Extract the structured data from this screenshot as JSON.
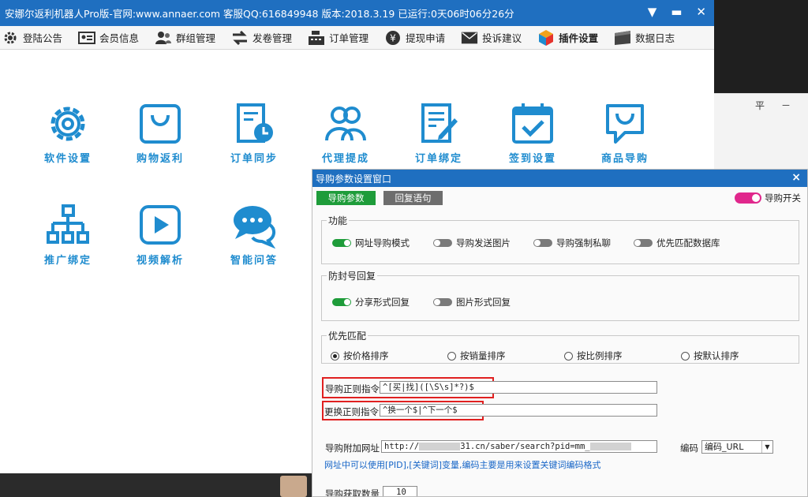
{
  "main_window": {
    "title": "安娜尔返利机器人Pro版-官网:www.annaer.com 客服QQ:616849948 版本:2018.3.19      已运行:0天06时06分26分"
  },
  "toolbar": {
    "items": [
      {
        "label": "登陆公告",
        "icon": "settings-icon"
      },
      {
        "label": "会员信息",
        "icon": "id-card-icon"
      },
      {
        "label": "群组管理",
        "icon": "users-icon"
      },
      {
        "label": "发卷管理",
        "icon": "exchange-icon"
      },
      {
        "label": "订单管理",
        "icon": "cash-register-icon"
      },
      {
        "label": "提现申请",
        "icon": "yen-icon"
      },
      {
        "label": "投诉建议",
        "icon": "mail-icon"
      },
      {
        "label": "插件设置",
        "icon": "cube-icon"
      },
      {
        "label": "数据日志",
        "icon": "database-icon"
      }
    ]
  },
  "tiles": [
    {
      "label": "软件设置",
      "icon": "gear-icon"
    },
    {
      "label": "购物返利",
      "icon": "shopping-bag-icon"
    },
    {
      "label": "订单同步",
      "icon": "order-clock-icon"
    },
    {
      "label": "代理提成",
      "icon": "agents-icon"
    },
    {
      "label": "订单绑定",
      "icon": "order-edit-icon"
    },
    {
      "label": "签到设置",
      "icon": "calendar-check-icon"
    },
    {
      "label": "商品导购",
      "icon": "chat-bag-icon"
    },
    {
      "label": "推广绑定",
      "icon": "org-chart-icon"
    },
    {
      "label": "视频解析",
      "icon": "play-icon"
    },
    {
      "label": "智能问答",
      "icon": "chat-bubbles-icon"
    }
  ],
  "background_window": {
    "controls": [
      "平",
      "－"
    ]
  },
  "dialog": {
    "title": "导购参数设置窗口",
    "close": "×",
    "tabs": [
      "导购参数",
      "回复语句"
    ],
    "master_switch": {
      "label": "导购开关",
      "on": true
    },
    "groups": {
      "features": {
        "title": "功能",
        "options": [
          {
            "label": "网址导购模式",
            "on": true
          },
          {
            "label": "导购发送图片",
            "on": false
          },
          {
            "label": "导购强制私聊",
            "on": false
          },
          {
            "label": "优先匹配数据库",
            "on": false
          }
        ]
      },
      "anti_ban": {
        "title": "防封号回复",
        "options": [
          {
            "label": "分享形式回复",
            "on": true
          },
          {
            "label": "图片形式回复",
            "on": false
          }
        ]
      },
      "priority": {
        "title": "优先匹配",
        "options": [
          {
            "label": "按价格排序",
            "selected": true
          },
          {
            "label": "按销量排序",
            "selected": false
          },
          {
            "label": "按比例排序",
            "selected": false
          },
          {
            "label": "按默认排序",
            "selected": false
          }
        ]
      }
    },
    "regex": {
      "label": "导购正则指令",
      "value": "^[买|找]([\\S\\s]*?)$"
    },
    "replace_regex": {
      "label": "更换正则指令",
      "value": "^换一个$|^下一个$"
    },
    "url": {
      "label": "导购附加网址",
      "value_start": "http://",
      "value_mid": "31.cn/saber/search?pid=mm_",
      "encoding_label": "编码",
      "encoding_value": "编码_URL"
    },
    "note": "网址中可以使用[PID],[关键词]变量,编码主要是用来设置关键词编码格式",
    "fetch_count": {
      "label": "导购获取数量",
      "value": "10"
    }
  },
  "colors": {
    "titlebar": "#1f6fc0",
    "tile_icon": "#1f8ccf",
    "tab_active": "#1e9c3a",
    "switch_on": "#1e9c3a",
    "master_switch": "#e0278c",
    "highlight_box": "#e02020",
    "note_text": "#1665c7"
  }
}
